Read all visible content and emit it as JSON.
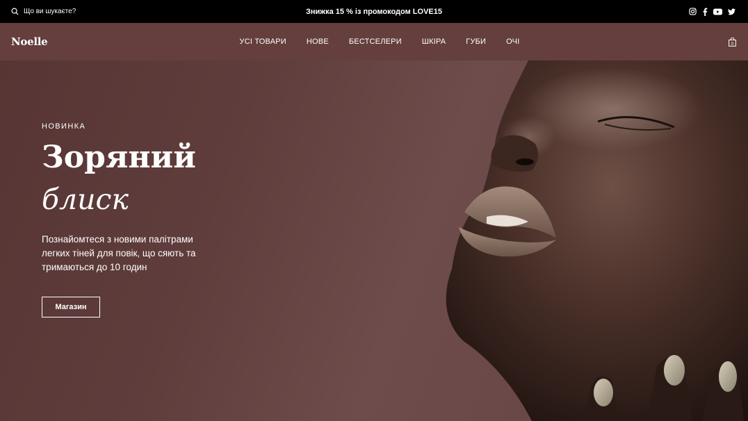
{
  "topbar": {
    "search_placeholder": "Що ви шукаєте?",
    "promo": "Знижка 15 % із промокодом LOVE15",
    "social": [
      "instagram-icon",
      "facebook-icon",
      "youtube-icon",
      "twitter-icon"
    ]
  },
  "header": {
    "logo": "Noelle",
    "nav": [
      "УСІ ТОВАРИ",
      "НОВЕ",
      "БЕСТСЕЛЕРИ",
      "ШКІРА",
      "ГУБИ",
      "ОЧІ"
    ],
    "cart_icon": "shopping-bag-icon",
    "cart_count": "0"
  },
  "hero": {
    "eyebrow": "НОВИНКА",
    "title_line1": "Зоряний",
    "title_line2": "блиск",
    "description": "Познайомтеся з новими палітрами легких тіней для повік, що сяють та тримаються до 10 годин",
    "cta": "Магазин"
  },
  "colors": {
    "topbar_bg": "#000000",
    "nav_bg": "#643f3d",
    "hero_bg": "#5f3d3c",
    "text": "#ffffff"
  }
}
